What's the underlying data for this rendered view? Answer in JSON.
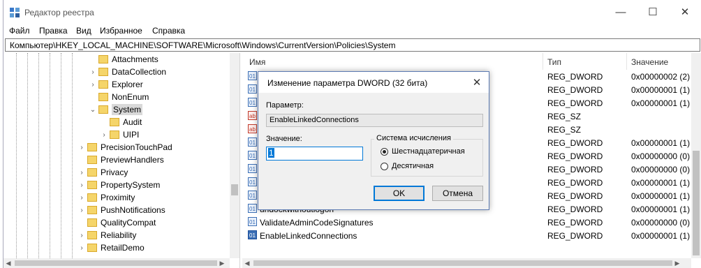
{
  "window": {
    "title": "Редактор реестра",
    "controls": {
      "minimize": "—",
      "maximize": "☐",
      "close": "✕"
    }
  },
  "menu": [
    "Файл",
    "Правка",
    "Вид",
    "Избранное",
    "Справка"
  ],
  "address": "Компьютер\\HKEY_LOCAL_MACHINE\\SOFTWARE\\Microsoft\\Windows\\CurrentVersion\\Policies\\System",
  "tree": {
    "items": [
      {
        "label": "Attachments",
        "expander": ""
      },
      {
        "label": "DataCollection",
        "expander": "›"
      },
      {
        "label": "Explorer",
        "expander": "›"
      },
      {
        "label": "NonEnum",
        "expander": ""
      },
      {
        "label": "System",
        "expander": "⌄"
      },
      {
        "label": "Audit",
        "expander": ""
      },
      {
        "label": "UIPI",
        "expander": "›"
      },
      {
        "label": "PrecisionTouchPad",
        "expander": "›"
      },
      {
        "label": "PreviewHandlers",
        "expander": ""
      },
      {
        "label": "Privacy",
        "expander": "›"
      },
      {
        "label": "PropertySystem",
        "expander": "›"
      },
      {
        "label": "Proximity",
        "expander": "›"
      },
      {
        "label": "PushNotifications",
        "expander": "›"
      },
      {
        "label": "QualityCompat",
        "expander": ""
      },
      {
        "label": "Reliability",
        "expander": "›"
      },
      {
        "label": "RetailDemo",
        "expander": "›"
      }
    ]
  },
  "list": {
    "columns": {
      "name": "Имя",
      "type": "Тип",
      "value": "Значение"
    },
    "rows": [
      {
        "icon": "binary-value-icon",
        "name": "",
        "type": "REG_DWORD",
        "value": "0x00000002 (2)"
      },
      {
        "icon": "binary-value-icon",
        "name": "",
        "type": "REG_DWORD",
        "value": "0x00000001 (1)"
      },
      {
        "icon": "binary-value-icon",
        "name": "",
        "type": "REG_DWORD",
        "value": "0x00000001 (1)"
      },
      {
        "icon": "string-value-icon",
        "name": "",
        "type": "REG_SZ",
        "value": ""
      },
      {
        "icon": "string-value-icon",
        "name": "",
        "type": "REG_SZ",
        "value": ""
      },
      {
        "icon": "binary-value-icon",
        "name": "",
        "type": "REG_DWORD",
        "value": "0x00000001 (1)"
      },
      {
        "icon": "binary-value-icon",
        "name": "",
        "type": "REG_DWORD",
        "value": "0x00000000 (0)"
      },
      {
        "icon": "binary-value-icon",
        "name": "",
        "type": "REG_DWORD",
        "value": "0x00000000 (0)"
      },
      {
        "icon": "binary-value-icon",
        "name": "",
        "type": "REG_DWORD",
        "value": "0x00000001 (1)"
      },
      {
        "icon": "binary-value-icon",
        "name": "",
        "type": "REG_DWORD",
        "value": "0x00000001 (1)"
      },
      {
        "icon": "binary-value-icon",
        "name": "undockwithoutlogon",
        "type": "REG_DWORD",
        "value": "0x00000001 (1)"
      },
      {
        "icon": "binary-value-icon",
        "name": "ValidateAdminCodeSignatures",
        "type": "REG_DWORD",
        "value": "0x00000000 (0)"
      },
      {
        "icon": "binary-value-icon",
        "name": "EnableLinkedConnections",
        "type": "REG_DWORD",
        "value": "0x00000001 (1)"
      }
    ]
  },
  "dialog": {
    "title": "Изменение параметра DWORD (32 бита)",
    "close": "✕",
    "param_label": "Параметр:",
    "param_value": "EnableLinkedConnections",
    "value_label": "Значение:",
    "value": "1",
    "radix_legend": "Система исчисления",
    "radix_hex": "Шестнадцатеричная",
    "radix_dec": "Десятичная",
    "radix_selected": "hex",
    "ok": "OK",
    "cancel": "Отмена"
  },
  "colors": {
    "accent": "#0078d7",
    "folder": "#f5d56a",
    "dialog_bg": "#f0f0f0"
  }
}
